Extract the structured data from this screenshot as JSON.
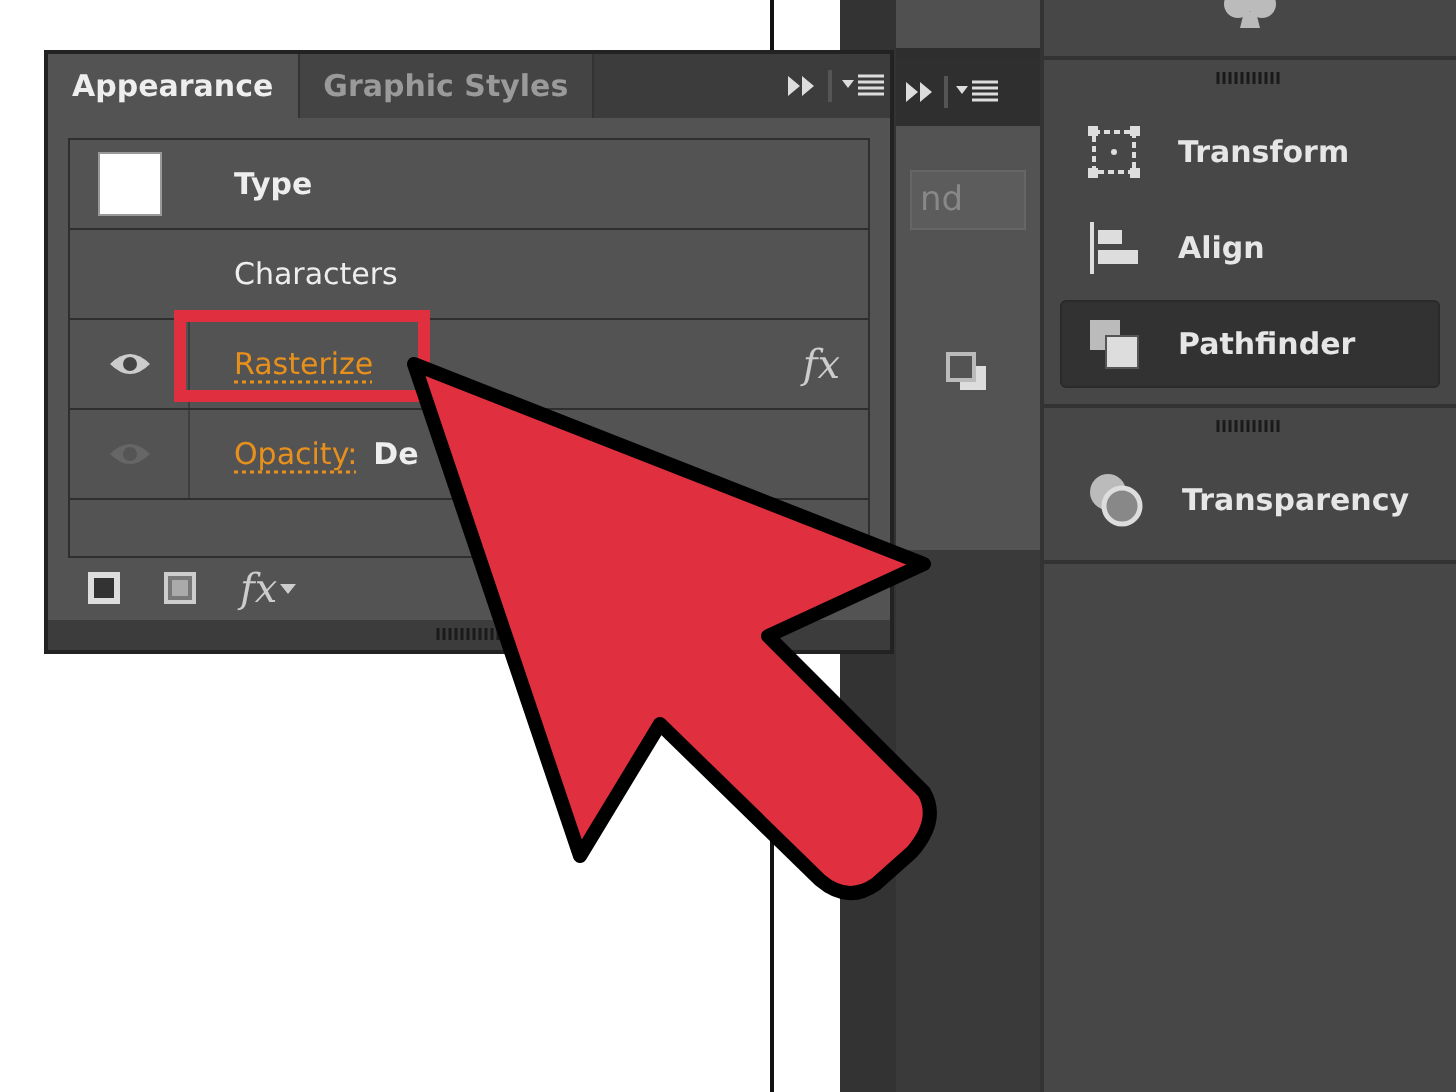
{
  "appearance_panel": {
    "tabs": [
      {
        "label": "Appearance",
        "selected": true
      },
      {
        "label": "Graphic Styles",
        "selected": false
      }
    ],
    "rows": [
      {
        "kind": "header",
        "label": "Type",
        "highlighted": false
      },
      {
        "kind": "plain",
        "label": "Characters",
        "highlighted": false
      },
      {
        "kind": "effect",
        "label": "Rasterize",
        "visible": true,
        "badge": "fx",
        "highlighted": true
      },
      {
        "kind": "attribute",
        "label": "Opacity:",
        "value": "De",
        "visible": false,
        "highlighted": false
      }
    ],
    "footer_menu": "fx"
  },
  "side_field": {
    "value": "nd"
  },
  "right_panel": {
    "groups": [
      [
        {
          "kind": "transform",
          "label": "Transform",
          "selected": false
        },
        {
          "kind": "align",
          "label": "Align",
          "selected": false
        },
        {
          "kind": "pathfinder",
          "label": "Pathfinder",
          "selected": true
        }
      ],
      [
        {
          "kind": "transparency",
          "label": "Transparency",
          "selected": false
        }
      ]
    ]
  }
}
